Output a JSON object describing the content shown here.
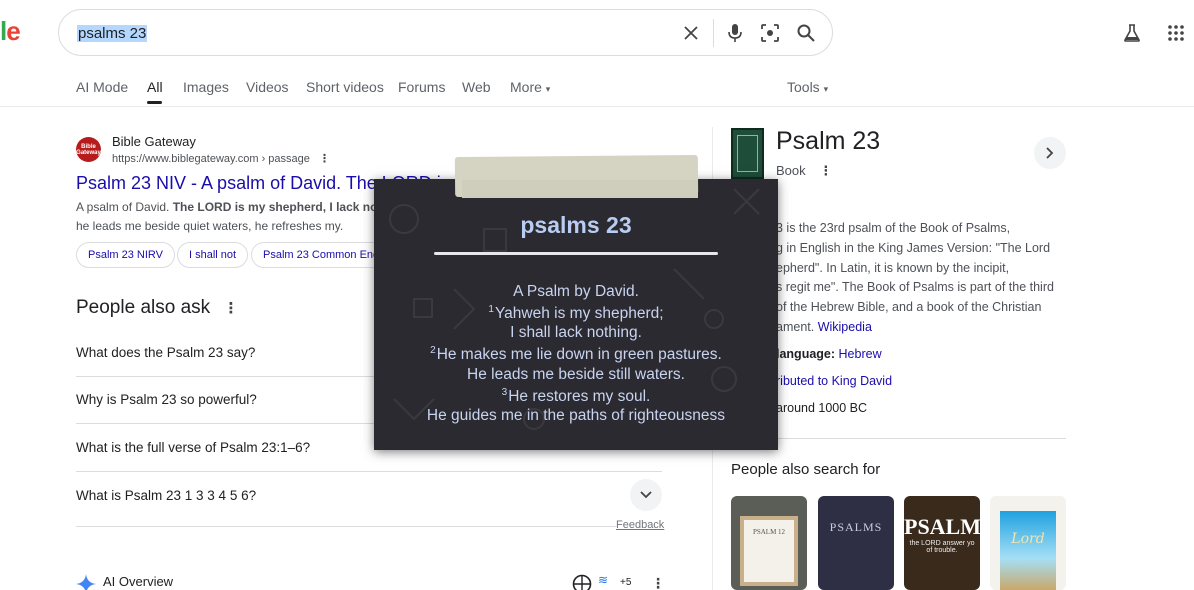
{
  "search": {
    "query": "psalms 23",
    "logo_fragment_l": "l",
    "logo_fragment_e": "e"
  },
  "tabs": [
    {
      "label": "AI Mode"
    },
    {
      "label": "All"
    },
    {
      "label": "Images"
    },
    {
      "label": "Videos"
    },
    {
      "label": "Short videos"
    },
    {
      "label": "Forums"
    },
    {
      "label": "Web"
    },
    {
      "label": "More"
    }
  ],
  "tools_label": "Tools",
  "result": {
    "favicon_text": "Bible Gateway",
    "site_name": "Bible Gateway",
    "url": "https://www.biblegateway.com › passage",
    "title": "Psalm 23 NIV - A psalm of David. The LORD i",
    "snippet_part1": "A psalm of David. ",
    "snippet_bold": "The LORD is my shepherd, I lack no",
    "snippet_line2": "he leads me beside quiet waters, he refreshes my.",
    "chips": [
      "Psalm 23 NIRV",
      "I shall not",
      "Psalm 23 Common Eng"
    ]
  },
  "paa": {
    "title": "People also ask",
    "questions": [
      "What does the Psalm 23 say?",
      "Why is Psalm 23 so powerful?",
      "What is the full verse of Psalm 23:1–6?",
      "What is Psalm 23 1 3 3 4 5 6?"
    ],
    "feedback": "Feedback"
  },
  "ai_overview": {
    "label": "AI Overview",
    "count": "+5"
  },
  "knowledge_panel": {
    "title": "Psalm 23",
    "subtitle": "Book",
    "desc_lines": [
      "3 is the 23rd psalm of the Book of Psalms,",
      "g in English in the King James Version: \"The Lord",
      "epherd\". In Latin, it is known by the incipit,",
      "s regit me\". The Book of Psalms is part of the third",
      "of the Hebrew Bible, and a book of the Christian",
      "ament."
    ],
    "wikipedia": "Wikipedia",
    "lang_label": "language:",
    "lang_value": "Hebrew",
    "attrib_value": "ributed to King David",
    "date_value": "around 1000 BC",
    "pasf_title": "People also search for",
    "pasf_cards": [
      "PSALM 12",
      "PSALMS",
      "PSALM",
      "Lord"
    ],
    "pasf_card3_sub": "the LORD answer yo of trouble."
  },
  "popup": {
    "title": "psalms 23",
    "lines": [
      {
        "num": "",
        "text": "A Psalm by David."
      },
      {
        "num": "1",
        "text": "Yahweh is my shepherd;"
      },
      {
        "num": "",
        "text": "I shall lack nothing."
      },
      {
        "num": "2",
        "text": "He makes me lie down in green pastures."
      },
      {
        "num": "",
        "text": "He leads me beside still waters."
      },
      {
        "num": "3",
        "text": "He restores my soul."
      },
      {
        "num": "",
        "text": "He guides me in the paths of righteousness"
      }
    ]
  },
  "colors": {
    "link": "#1a0dab",
    "popup_bg": "#2b2a30",
    "popup_text": "#c8d4f0",
    "popup_title": "#b9ccf2"
  }
}
